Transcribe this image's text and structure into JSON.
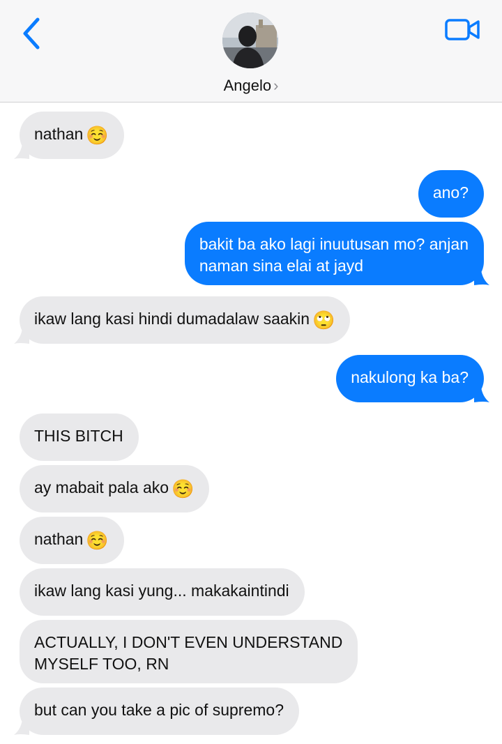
{
  "header": {
    "contact_name": "Angelo",
    "chevron": "›",
    "back_icon": "chevron-left-icon",
    "video_icon": "video-camera-icon",
    "accent": "#0a7cff"
  },
  "colors": {
    "incoming_bubble": "#e9e9eb",
    "outgoing_bubble": "#0a7cff"
  },
  "messages": [
    {
      "direction": "incoming",
      "text": "nathan",
      "emoji": "☺️"
    },
    {
      "direction": "outgoing",
      "text": "ano?"
    },
    {
      "direction": "outgoing",
      "text": "bakit ba ako lagi inuutusan mo? anjan\nnaman sina elai at jayd"
    },
    {
      "direction": "incoming",
      "text": "ikaw lang kasi hindi dumadalaw saakin",
      "emoji": "🙄"
    },
    {
      "direction": "outgoing",
      "text": "nakulong ka ba?"
    },
    {
      "direction": "incoming",
      "text": "THIS BITCH"
    },
    {
      "direction": "incoming",
      "text": "ay mabait pala ako",
      "emoji": "☺️"
    },
    {
      "direction": "incoming",
      "text": "nathan",
      "emoji": "☺️"
    },
    {
      "direction": "incoming",
      "text": "ikaw lang kasi yung... makakaintindi"
    },
    {
      "direction": "incoming",
      "text": "ACTUALLY, I DON'T EVEN UNDERSTAND\nMYSELF TOO, RN"
    },
    {
      "direction": "incoming",
      "text": "but can you take a pic of supremo?"
    }
  ]
}
